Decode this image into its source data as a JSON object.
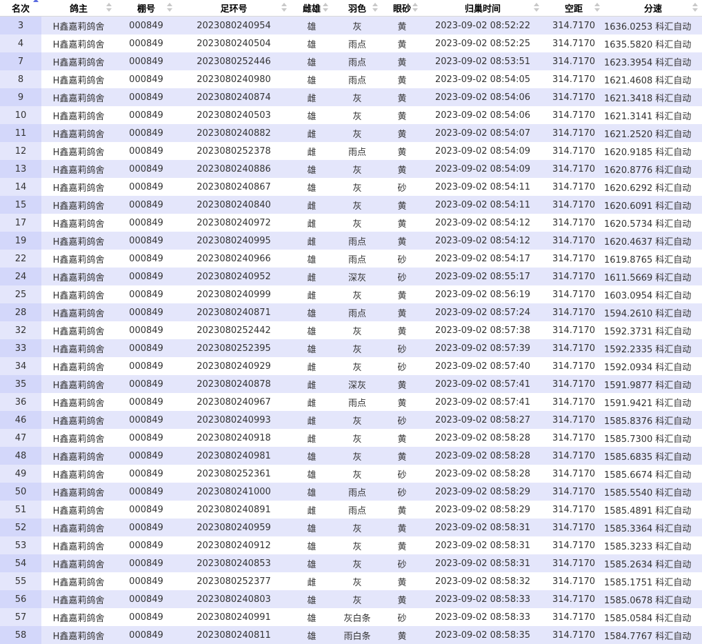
{
  "colors": {
    "row_alt": "#e4e6fb",
    "row_plain": "#ffffff",
    "rank_col_alt": "#d3d7fa",
    "sort_active": "#5a6be0"
  },
  "headers": {
    "rank": "名次",
    "owner": "鸽主",
    "loft": "棚号",
    "ring": "足环号",
    "sex": "雌雄",
    "color": "羽色",
    "eye": "眼砂",
    "arrival": "归巢时间",
    "distance": "空距",
    "speed": "分速"
  },
  "rows": [
    {
      "rank": "3",
      "owner": "H鑫嘉莉鸽舍",
      "loft": "000849",
      "ring": "2023080240954",
      "sex": "雄",
      "color": "灰",
      "eye": "黄",
      "arrival": "2023-09-02 08:52:22",
      "distance": "314.7170",
      "speed": "1636.0253 科汇自动"
    },
    {
      "rank": "4",
      "owner": "H鑫嘉莉鸽舍",
      "loft": "000849",
      "ring": "2023080240504",
      "sex": "雄",
      "color": "雨点",
      "eye": "黄",
      "arrival": "2023-09-02 08:52:25",
      "distance": "314.7170",
      "speed": "1635.5820 科汇自动"
    },
    {
      "rank": "7",
      "owner": "H鑫嘉莉鸽舍",
      "loft": "000849",
      "ring": "2023080252446",
      "sex": "雄",
      "color": "雨点",
      "eye": "黄",
      "arrival": "2023-09-02 08:53:51",
      "distance": "314.7170",
      "speed": "1623.3954 科汇自动"
    },
    {
      "rank": "8",
      "owner": "H鑫嘉莉鸽舍",
      "loft": "000849",
      "ring": "2023080240980",
      "sex": "雄",
      "color": "雨点",
      "eye": "黄",
      "arrival": "2023-09-02 08:54:05",
      "distance": "314.7170",
      "speed": "1621.4608 科汇自动"
    },
    {
      "rank": "9",
      "owner": "H鑫嘉莉鸽舍",
      "loft": "000849",
      "ring": "2023080240874",
      "sex": "雌",
      "color": "灰",
      "eye": "黄",
      "arrival": "2023-09-02 08:54:06",
      "distance": "314.7170",
      "speed": "1621.3418 科汇自动"
    },
    {
      "rank": "10",
      "owner": "H鑫嘉莉鸽舍",
      "loft": "000849",
      "ring": "2023080240503",
      "sex": "雄",
      "color": "灰",
      "eye": "黄",
      "arrival": "2023-09-02 08:54:06",
      "distance": "314.7170",
      "speed": "1621.3141 科汇自动"
    },
    {
      "rank": "11",
      "owner": "H鑫嘉莉鸽舍",
      "loft": "000849",
      "ring": "2023080240882",
      "sex": "雌",
      "color": "灰",
      "eye": "黄",
      "arrival": "2023-09-02 08:54:07",
      "distance": "314.7170",
      "speed": "1621.2520 科汇自动"
    },
    {
      "rank": "12",
      "owner": "H鑫嘉莉鸽舍",
      "loft": "000849",
      "ring": "2023080252378",
      "sex": "雌",
      "color": "雨点",
      "eye": "黄",
      "arrival": "2023-09-02 08:54:09",
      "distance": "314.7170",
      "speed": "1620.9185 科汇自动"
    },
    {
      "rank": "13",
      "owner": "H鑫嘉莉鸽舍",
      "loft": "000849",
      "ring": "2023080240886",
      "sex": "雄",
      "color": "灰",
      "eye": "黄",
      "arrival": "2023-09-02 08:54:09",
      "distance": "314.7170",
      "speed": "1620.8776 科汇自动"
    },
    {
      "rank": "14",
      "owner": "H鑫嘉莉鸽舍",
      "loft": "000849",
      "ring": "2023080240867",
      "sex": "雄",
      "color": "灰",
      "eye": "砂",
      "arrival": "2023-09-02 08:54:11",
      "distance": "314.7170",
      "speed": "1620.6292 科汇自动"
    },
    {
      "rank": "15",
      "owner": "H鑫嘉莉鸽舍",
      "loft": "000849",
      "ring": "2023080240840",
      "sex": "雌",
      "color": "灰",
      "eye": "黄",
      "arrival": "2023-09-02 08:54:11",
      "distance": "314.7170",
      "speed": "1620.6091 科汇自动"
    },
    {
      "rank": "17",
      "owner": "H鑫嘉莉鸽舍",
      "loft": "000849",
      "ring": "2023080240972",
      "sex": "雌",
      "color": "灰",
      "eye": "黄",
      "arrival": "2023-09-02 08:54:12",
      "distance": "314.7170",
      "speed": "1620.5734 科汇自动"
    },
    {
      "rank": "19",
      "owner": "H鑫嘉莉鸽舍",
      "loft": "000849",
      "ring": "2023080240995",
      "sex": "雌",
      "color": "雨点",
      "eye": "黄",
      "arrival": "2023-09-02 08:54:12",
      "distance": "314.7170",
      "speed": "1620.4637 科汇自动"
    },
    {
      "rank": "22",
      "owner": "H鑫嘉莉鸽舍",
      "loft": "000849",
      "ring": "2023080240966",
      "sex": "雄",
      "color": "雨点",
      "eye": "砂",
      "arrival": "2023-09-02 08:54:17",
      "distance": "314.7170",
      "speed": "1619.8765 科汇自动"
    },
    {
      "rank": "24",
      "owner": "H鑫嘉莉鸽舍",
      "loft": "000849",
      "ring": "2023080240952",
      "sex": "雌",
      "color": "深灰",
      "eye": "砂",
      "arrival": "2023-09-02 08:55:17",
      "distance": "314.7170",
      "speed": "1611.5669 科汇自动"
    },
    {
      "rank": "25",
      "owner": "H鑫嘉莉鸽舍",
      "loft": "000849",
      "ring": "2023080240999",
      "sex": "雌",
      "color": "灰",
      "eye": "黄",
      "arrival": "2023-09-02 08:56:19",
      "distance": "314.7170",
      "speed": "1603.0954 科汇自动"
    },
    {
      "rank": "28",
      "owner": "H鑫嘉莉鸽舍",
      "loft": "000849",
      "ring": "2023080240871",
      "sex": "雄",
      "color": "雨点",
      "eye": "黄",
      "arrival": "2023-09-02 08:57:24",
      "distance": "314.7170",
      "speed": "1594.2610 科汇自动"
    },
    {
      "rank": "32",
      "owner": "H鑫嘉莉鸽舍",
      "loft": "000849",
      "ring": "2023080252442",
      "sex": "雄",
      "color": "灰",
      "eye": "黄",
      "arrival": "2023-09-02 08:57:38",
      "distance": "314.7170",
      "speed": "1592.3731 科汇自动"
    },
    {
      "rank": "33",
      "owner": "H鑫嘉莉鸽舍",
      "loft": "000849",
      "ring": "2023080252395",
      "sex": "雄",
      "color": "灰",
      "eye": "砂",
      "arrival": "2023-09-02 08:57:39",
      "distance": "314.7170",
      "speed": "1592.2335 科汇自动"
    },
    {
      "rank": "34",
      "owner": "H鑫嘉莉鸽舍",
      "loft": "000849",
      "ring": "2023080240929",
      "sex": "雌",
      "color": "灰",
      "eye": "砂",
      "arrival": "2023-09-02 08:57:40",
      "distance": "314.7170",
      "speed": "1592.0934 科汇自动"
    },
    {
      "rank": "35",
      "owner": "H鑫嘉莉鸽舍",
      "loft": "000849",
      "ring": "2023080240878",
      "sex": "雌",
      "color": "深灰",
      "eye": "黄",
      "arrival": "2023-09-02 08:57:41",
      "distance": "314.7170",
      "speed": "1591.9877 科汇自动"
    },
    {
      "rank": "36",
      "owner": "H鑫嘉莉鸽舍",
      "loft": "000849",
      "ring": "2023080240967",
      "sex": "雌",
      "color": "雨点",
      "eye": "黄",
      "arrival": "2023-09-02 08:57:41",
      "distance": "314.7170",
      "speed": "1591.9421 科汇自动"
    },
    {
      "rank": "46",
      "owner": "H鑫嘉莉鸽舍",
      "loft": "000849",
      "ring": "2023080240993",
      "sex": "雌",
      "color": "灰",
      "eye": "砂",
      "arrival": "2023-09-02 08:58:27",
      "distance": "314.7170",
      "speed": "1585.8376 科汇自动"
    },
    {
      "rank": "47",
      "owner": "H鑫嘉莉鸽舍",
      "loft": "000849",
      "ring": "2023080240918",
      "sex": "雌",
      "color": "灰",
      "eye": "黄",
      "arrival": "2023-09-02 08:58:28",
      "distance": "314.7170",
      "speed": "1585.7300 科汇自动"
    },
    {
      "rank": "48",
      "owner": "H鑫嘉莉鸽舍",
      "loft": "000849",
      "ring": "2023080240981",
      "sex": "雄",
      "color": "灰",
      "eye": "黄",
      "arrival": "2023-09-02 08:58:28",
      "distance": "314.7170",
      "speed": "1585.6835 科汇自动"
    },
    {
      "rank": "49",
      "owner": "H鑫嘉莉鸽舍",
      "loft": "000849",
      "ring": "2023080252361",
      "sex": "雄",
      "color": "灰",
      "eye": "砂",
      "arrival": "2023-09-02 08:58:28",
      "distance": "314.7170",
      "speed": "1585.6674 科汇自动"
    },
    {
      "rank": "50",
      "owner": "H鑫嘉莉鸽舍",
      "loft": "000849",
      "ring": "2023080241000",
      "sex": "雄",
      "color": "雨点",
      "eye": "砂",
      "arrival": "2023-09-02 08:58:29",
      "distance": "314.7170",
      "speed": "1585.5540 科汇自动"
    },
    {
      "rank": "51",
      "owner": "H鑫嘉莉鸽舍",
      "loft": "000849",
      "ring": "2023080240891",
      "sex": "雌",
      "color": "雨点",
      "eye": "黄",
      "arrival": "2023-09-02 08:58:29",
      "distance": "314.7170",
      "speed": "1585.4891 科汇自动"
    },
    {
      "rank": "52",
      "owner": "H鑫嘉莉鸽舍",
      "loft": "000849",
      "ring": "2023080240959",
      "sex": "雄",
      "color": "灰",
      "eye": "黄",
      "arrival": "2023-09-02 08:58:31",
      "distance": "314.7170",
      "speed": "1585.3364 科汇自动"
    },
    {
      "rank": "53",
      "owner": "H鑫嘉莉鸽舍",
      "loft": "000849",
      "ring": "2023080240912",
      "sex": "雄",
      "color": "灰",
      "eye": "黄",
      "arrival": "2023-09-02 08:58:31",
      "distance": "314.7170",
      "speed": "1585.3233 科汇自动"
    },
    {
      "rank": "54",
      "owner": "H鑫嘉莉鸽舍",
      "loft": "000849",
      "ring": "2023080240853",
      "sex": "雄",
      "color": "灰",
      "eye": "砂",
      "arrival": "2023-09-02 08:58:31",
      "distance": "314.7170",
      "speed": "1585.2634 科汇自动"
    },
    {
      "rank": "55",
      "owner": "H鑫嘉莉鸽舍",
      "loft": "000849",
      "ring": "2023080252377",
      "sex": "雌",
      "color": "灰",
      "eye": "黄",
      "arrival": "2023-09-02 08:58:32",
      "distance": "314.7170",
      "speed": "1585.1751 科汇自动"
    },
    {
      "rank": "56",
      "owner": "H鑫嘉莉鸽舍",
      "loft": "000849",
      "ring": "2023080240803",
      "sex": "雄",
      "color": "灰",
      "eye": "黄",
      "arrival": "2023-09-02 08:58:33",
      "distance": "314.7170",
      "speed": "1585.0678 科汇自动"
    },
    {
      "rank": "57",
      "owner": "H鑫嘉莉鸽舍",
      "loft": "000849",
      "ring": "2023080240991",
      "sex": "雄",
      "color": "灰白条",
      "eye": "砂",
      "arrival": "2023-09-02 08:58:33",
      "distance": "314.7170",
      "speed": "1585.0584 科汇自动"
    },
    {
      "rank": "58",
      "owner": "H鑫嘉莉鸽舍",
      "loft": "000849",
      "ring": "2023080240811",
      "sex": "雄",
      "color": "雨白条",
      "eye": "黄",
      "arrival": "2023-09-02 08:58:35",
      "distance": "314.7170",
      "speed": "1584.7767 科汇自动"
    }
  ]
}
